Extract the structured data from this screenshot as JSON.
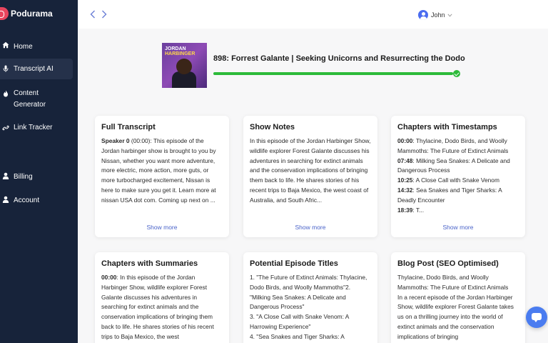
{
  "app": {
    "name": "Podurama"
  },
  "sidebar": {
    "items": [
      {
        "label": "Home",
        "icon": "home-icon",
        "active": false
      },
      {
        "label": "Transcript AI",
        "icon": "mic-icon",
        "active": true
      },
      {
        "label": "Content Generator",
        "label_line1": "Content",
        "label_line2": "Generator",
        "icon": "flame-icon",
        "active": false
      },
      {
        "label": "Link Tracker",
        "icon": "link-icon",
        "active": false
      },
      {
        "label": "Billing",
        "icon": "person-icon",
        "active": false
      },
      {
        "label": "Account",
        "icon": "person-icon",
        "active": false
      }
    ]
  },
  "header": {
    "back_icon": "chevron-left-icon",
    "forward_icon": "chevron-right-icon",
    "user": {
      "name": "John",
      "icon": "user-avatar-icon",
      "dropdown_icon": "chevron-down-icon"
    }
  },
  "episode": {
    "cover": {
      "line1": "JORDAN",
      "line2": "HARBINGER"
    },
    "title": "898: Forrest Galante | Seeking Unicorns and Resurrecting the Dodo",
    "progress": 1.0,
    "status_icon": "check-circle-icon"
  },
  "cards": [
    {
      "title": "Full Transcript",
      "lead": "Speaker 0",
      "body": " (00:00): This episode of the Jordan harbinger show is brought to you by Nissan, whether you want more adventure, more electric, more action, more guts, or more turbocharged excitement, Nissan is here to make sure you get it. Learn more at nissan USA dot com. Coming up next on ...",
      "show_more": "Show more"
    },
    {
      "title": "Show Notes",
      "body": "In this episode of the Jordan Harbinger Show, wildlife explorer Forest Galante discusses his adventures in searching for extinct animals and the conservation implications of bringing them back to life. He shares stories of his recent trips to Baja Mexico, the west coast of Australia, and South Afric...",
      "show_more": "Show more"
    },
    {
      "title": "Chapters with Timestamps",
      "chapters": [
        {
          "time": "00:00",
          "text": ": Thylacine, Dodo Birds, and Woolly Mammoths: The Future of Extinct Animals"
        },
        {
          "time": "07:48",
          "text": ": Milking Sea Snakes: A Delicate and Dangerous Process"
        },
        {
          "time": "10:25",
          "text": ": A Close Call with Snake Venom"
        },
        {
          "time": "14:32",
          "text": ": Sea Snakes and Tiger Sharks: A Deadly Encounter"
        },
        {
          "time": "18:39",
          "text": ": T..."
        }
      ],
      "show_more": "Show more"
    },
    {
      "title": "Chapters with Summaries",
      "lead": "00:00",
      "body": ": In this episode of the Jordan Harbinger Show, wildlife explorer Forest Galante discusses his adventures in searching for extinct animals and the conservation implications of bringing them back to life. He shares stories of his recent trips to Baja Mexico, the west"
    },
    {
      "title": "Potential Episode Titles",
      "body": "1. \"The Future of Extinct Animals: Thylacine, Dodo Birds, and Woolly Mammoths\"2. \"Milking Sea Snakes: A Delicate and Dangerous Process\"\n3. \"A Close Call with Snake Venom: A Harrowing Experience\"\n4. \"Sea Snakes and Tiger Sharks: A"
    },
    {
      "title": "Blog Post (SEO Optimised)",
      "body": "Thylacine, Dodo Birds, and Woolly Mammoths: The Future of Extinct Animals\nIn a recent episode of the Jordan Harbinger Show, wildlife explorer Forest Galante takes us on a thrilling journey into the world of extinct animals and the conservation implications of bringing"
    }
  ],
  "chat": {
    "icon": "chat-icon"
  },
  "colors": {
    "sidebar_bg": "#17233a",
    "accent": "#4a63c9",
    "progress": "#2dbb3a",
    "brand": "#e8455e"
  }
}
